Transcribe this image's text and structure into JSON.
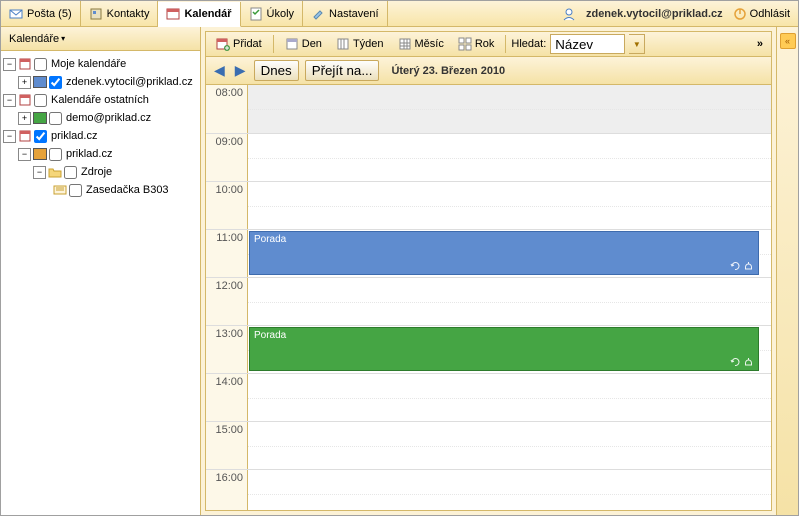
{
  "tabs": {
    "mail": "Pošta (5)",
    "contacts": "Kontakty",
    "calendar": "Kalendář",
    "tasks": "Úkoly",
    "settings": "Nastavení"
  },
  "user": {
    "email": "zdenek.vytocil@priklad.cz",
    "logout": "Odhlásit"
  },
  "sidebar": {
    "title": "Kalendáře",
    "nodes": {
      "my_calendars": "Moje kalendáře",
      "user_cal": "zdenek.vytocil@priklad.cz",
      "others": "Kalendáře ostatních",
      "demo": "demo@priklad.cz",
      "domain": "priklad.cz",
      "domain2": "priklad.cz",
      "resources": "Zdroje",
      "room": "Zasedačka B303"
    },
    "colors": {
      "user": "#5f8ccf",
      "demo": "#45a544",
      "domain": "#e5a23a"
    }
  },
  "toolbar": {
    "add": "Přidat",
    "day": "Den",
    "week": "Týden",
    "month": "Měsíc",
    "year": "Rok",
    "search_label": "Hledat:",
    "search_value": "Název"
  },
  "datebar": {
    "today": "Dnes",
    "goto": "Přejít na...",
    "title": "Úterý 23. Březen 2010"
  },
  "hours": [
    "08:00",
    "09:00",
    "10:00",
    "11:00",
    "12:00",
    "13:00",
    "14:00",
    "15:00",
    "16:00"
  ],
  "events": {
    "e1": {
      "title": "Porada"
    },
    "e2": {
      "title": "Porada"
    }
  }
}
